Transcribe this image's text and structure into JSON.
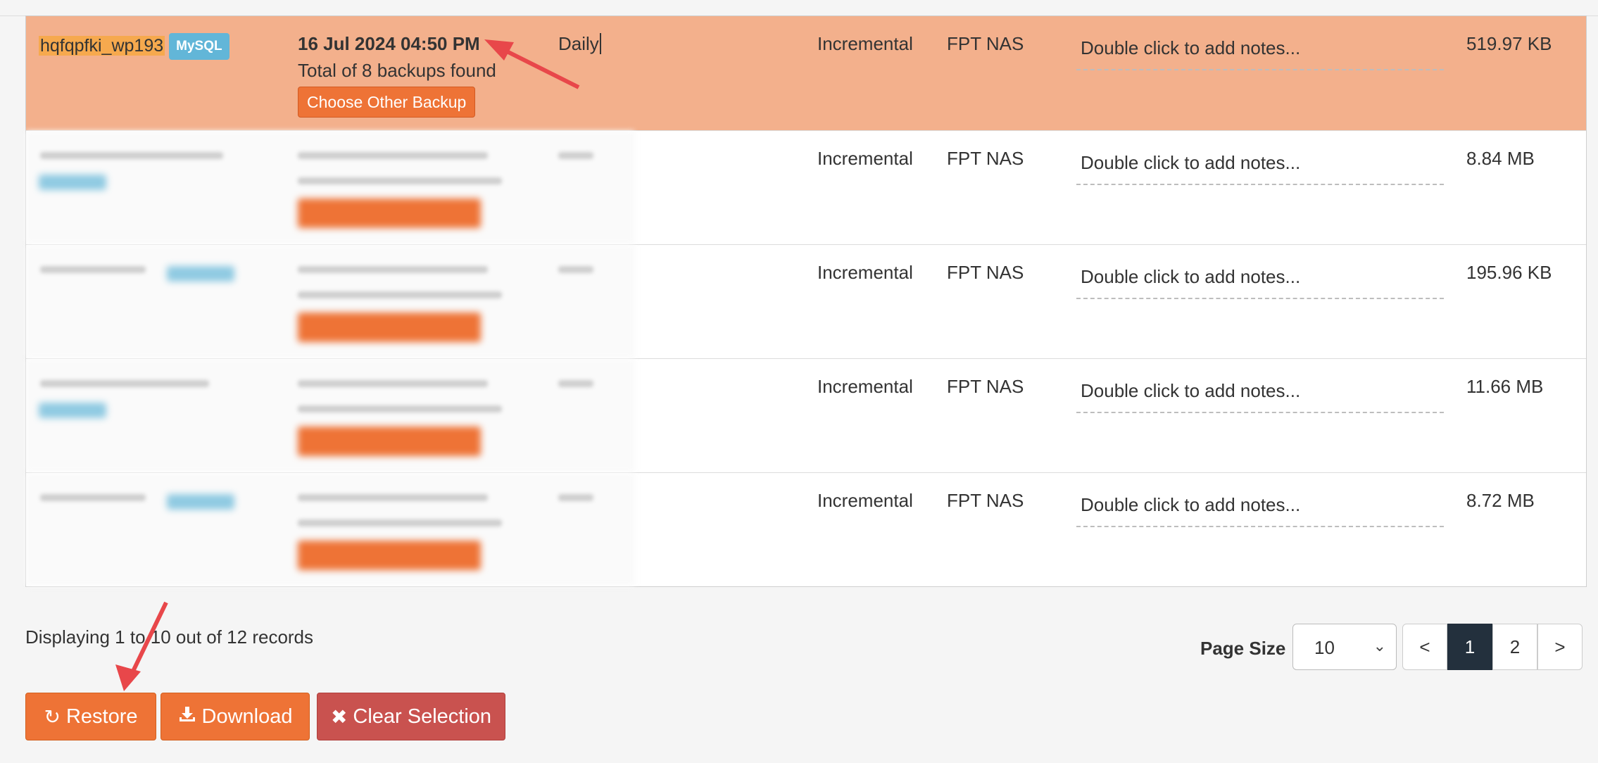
{
  "rows": [
    {
      "name": "hqfqpfki_wp193",
      "badge": "MySQL",
      "date": "16 Jul 2024 04:50 PM",
      "count": "Total of 8 backups found",
      "choose": "Choose Other Backup",
      "frequency": "Daily",
      "type": "Incremental",
      "storage": "FPT NAS",
      "notes": "Double click to add notes...",
      "size": "519.97 KB"
    },
    {
      "type": "Incremental",
      "storage": "FPT NAS",
      "notes": "Double click to add notes...",
      "size": "8.84 MB"
    },
    {
      "type": "Incremental",
      "storage": "FPT NAS",
      "notes": "Double click to add notes...",
      "size": "195.96 KB"
    },
    {
      "type": "Incremental",
      "storage": "FPT NAS",
      "notes": "Double click to add notes...",
      "size": "11.66 MB"
    },
    {
      "type": "Incremental",
      "storage": "FPT NAS",
      "notes": "Double click to add notes...",
      "size": "8.72 MB"
    }
  ],
  "footer": {
    "display": "Displaying 1 to 10 out of 12 records",
    "page_size_label": "Page Size",
    "page_size_value": "10",
    "prev": "<",
    "pages": [
      "1",
      "2"
    ],
    "next": ">"
  },
  "actions": {
    "restore": "Restore",
    "download": "Download",
    "clear": "Clear Selection"
  },
  "colors": {
    "selected_row": "#f3b08c",
    "accent": "#ee7336",
    "danger": "#c9524f",
    "badge": "#62b6d8",
    "annotation_arrow": "#e8474a"
  }
}
